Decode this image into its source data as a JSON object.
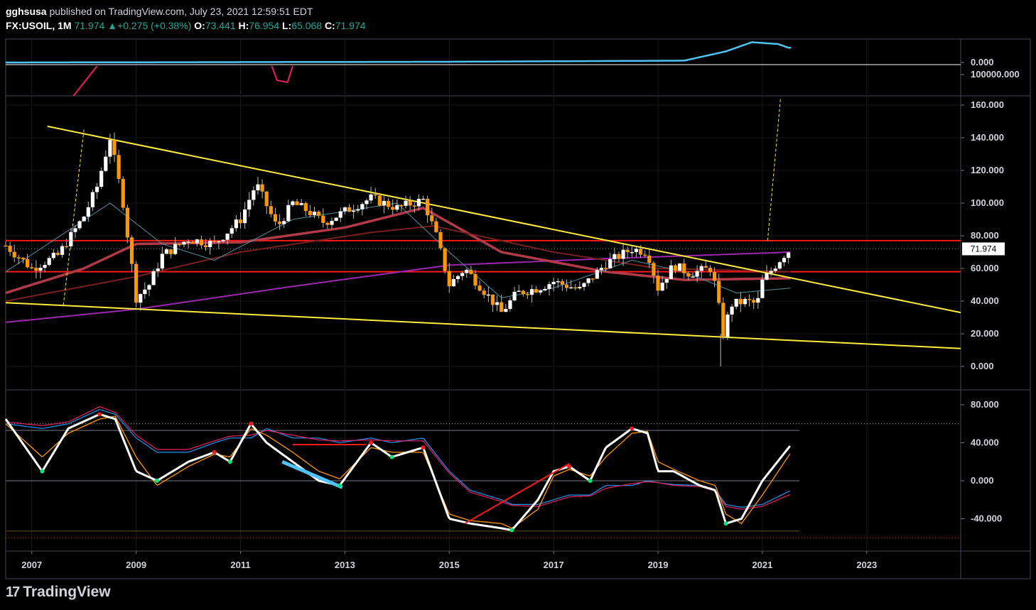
{
  "header": {
    "author": "gghsusa",
    "published_text": " published on TradingView.com, July 23, 2021 12:59:51 EDT",
    "symbol": "FX:USOIL, 1M",
    "last": "71.974",
    "change_arrow": "▲",
    "change": "+0.275 (+0.38%)",
    "open_label": "O:",
    "open": "73.441",
    "high_label": "H:",
    "high": "76.954",
    "low_label": "L:",
    "low": "65.068",
    "close_label": "C:",
    "close": "71.974"
  },
  "footer": {
    "brand": "TradingView",
    "logo_glyph": "17"
  },
  "colors": {
    "background": "#000000",
    "bull_candle": "#ffffff",
    "bear_candle": "#ff9800",
    "trendline": "#ffeb3b",
    "support_resistance": "#ff1a1a",
    "ma_purple": "#9c27b0",
    "ma_red": "#b23a48",
    "ma_dark": "#7a1f1f",
    "ma_teal": "#4f8f9f",
    "oscillator_fast": "#ffffff",
    "oscillator_slow": "#ff9800",
    "top_indicator": "#4fc3f7"
  },
  "chart_data": [
    {
      "type": "line",
      "panel": "top indicator",
      "y_tick_labels": [
        "0.000",
        "100000.000"
      ],
      "series": [
        {
          "values_note": "",
          "x": [
            2006.5,
            2015,
            2019.5,
            2020.3,
            2020.8,
            2021.3,
            2021.5
          ],
          "values": [
            0,
            0.2,
            0.5,
            3,
            5.5,
            5,
            4
          ]
        }
      ]
    },
    {
      "type": "candlestick",
      "panel": "price",
      "xlabel": "",
      "ylabel": "",
      "x_tick_labels": [
        "2007",
        "2009",
        "2011",
        "2013",
        "2015",
        "2017",
        "2019",
        "2021",
        "2023"
      ],
      "y_tick_labels": [
        "0.000",
        "20.000",
        "40.000",
        "60.000",
        "80.000",
        "100.000",
        "120.000",
        "140.000",
        "160.000"
      ],
      "ylim": [
        0,
        160
      ],
      "last_price_label": "71.974",
      "horizontal_levels": [
        77,
        58
      ],
      "trendlines": [
        {
          "x": [
            2007.3,
            2024.8
          ],
          "y": [
            147,
            33
          ]
        },
        {
          "x": [
            2006.5,
            2024.8
          ],
          "y": [
            39,
            11
          ]
        }
      ],
      "projection": {
        "x": [
          2021.1,
          2021.35
        ],
        "y": [
          77,
          165
        ]
      },
      "close_series": {
        "x": [
          2006.5,
          2007.0,
          2007.5,
          2008.0,
          2008.25,
          2008.5,
          2008.75,
          2009.0,
          2009.25,
          2009.5,
          2010.0,
          2010.5,
          2011.0,
          2011.3,
          2011.7,
          2012.0,
          2012.3,
          2012.6,
          2013.0,
          2013.5,
          2014.0,
          2014.5,
          2014.75,
          2015.0,
          2015.3,
          2015.7,
          2016.0,
          2016.3,
          2016.7,
          2017.0,
          2017.5,
          2018.0,
          2018.5,
          2018.8,
          2019.0,
          2019.3,
          2019.6,
          2020.0,
          2020.1,
          2020.25,
          2020.4,
          2020.7,
          2020.9,
          2021.0,
          2021.2,
          2021.4,
          2021.55
        ],
        "values": [
          74,
          60,
          68,
          92,
          110,
          140,
          100,
          42,
          50,
          68,
          78,
          75,
          90,
          112,
          85,
          100,
          95,
          88,
          95,
          103,
          97,
          102,
          80,
          50,
          60,
          45,
          33,
          45,
          48,
          52,
          47,
          63,
          72,
          70,
          48,
          62,
          57,
          60,
          49,
          20,
          38,
          40,
          38,
          52,
          60,
          68,
          72
        ]
      },
      "moving_averages": [
        {
          "color": "#9c27b0",
          "x": [
            2006.5,
            2009,
            2012,
            2015,
            2018,
            2021.55
          ],
          "values": [
            27,
            35,
            49,
            62,
            66,
            70
          ]
        },
        {
          "color": "#b23a48",
          "x": [
            2006.5,
            2008,
            2009,
            2011,
            2013,
            2014.5,
            2016,
            2018,
            2019.5,
            2021.55
          ],
          "values": [
            45,
            60,
            75,
            76,
            85,
            97,
            70,
            58,
            53,
            54
          ]
        },
        {
          "color": "#7a1f1f",
          "x": [
            2006.5,
            2009,
            2011,
            2013.5,
            2014.7,
            2017,
            2019,
            2021.55
          ],
          "values": [
            40,
            55,
            70,
            82,
            86,
            70,
            60,
            58
          ]
        },
        {
          "color": "#4f8f9f",
          "x": [
            2006.5,
            2008.5,
            2009.5,
            2010.5,
            2012,
            2014,
            2015,
            2016,
            2017,
            2018.5,
            2019.5,
            2020.5,
            2021.55
          ],
          "values": [
            58,
            100,
            75,
            65,
            90,
            100,
            70,
            42,
            48,
            65,
            58,
            45,
            48
          ]
        }
      ]
    },
    {
      "type": "line",
      "panel": "oscillator",
      "y_tick_labels": [
        "-40.000",
        "0.000",
        "40.000",
        "80.000"
      ],
      "ylim": [
        -60,
        80
      ],
      "levels": [
        53,
        0,
        -53
      ],
      "x": [
        2006.5,
        2007.2,
        2007.7,
        2008.3,
        2008.6,
        2009.0,
        2009.4,
        2010.0,
        2010.5,
        2010.8,
        2011.2,
        2011.5,
        2012.0,
        2012.5,
        2012.9,
        2013.5,
        2013.9,
        2014.5,
        2015.0,
        2015.4,
        2016.0,
        2016.2,
        2016.7,
        2017.0,
        2017.3,
        2017.7,
        2018.0,
        2018.5,
        2018.8,
        2019.0,
        2019.3,
        2019.8,
        2020.1,
        2020.3,
        2020.6,
        2021.0,
        2021.55
      ],
      "series": [
        {
          "values": [
            65,
            10,
            55,
            70,
            65,
            10,
            0,
            20,
            30,
            20,
            60,
            40,
            20,
            0,
            -5,
            40,
            25,
            35,
            -40,
            -45,
            -50,
            -52,
            -20,
            10,
            15,
            0,
            35,
            55,
            50,
            10,
            10,
            -5,
            -10,
            -45,
            -40,
            0,
            38
          ]
        },
        {
          "values": [
            60,
            25,
            50,
            65,
            68,
            25,
            -5,
            15,
            28,
            25,
            55,
            48,
            30,
            10,
            2,
            35,
            30,
            30,
            -35,
            -42,
            -45,
            -50,
            -30,
            5,
            12,
            5,
            25,
            50,
            52,
            20,
            12,
            0,
            -5,
            -35,
            -45,
            -15,
            30
          ]
        },
        {
          "values": [
            60,
            55,
            60,
            75,
            70,
            45,
            30,
            30,
            40,
            45,
            45,
            55,
            45,
            45,
            40,
            45,
            40,
            45,
            10,
            -10,
            -20,
            -25,
            -25,
            -20,
            -15,
            -15,
            -5,
            -5,
            0,
            -2,
            -4,
            -5,
            -10,
            -25,
            -28,
            -25,
            -10
          ]
        },
        {
          "values": [
            62,
            58,
            62,
            78,
            72,
            48,
            33,
            33,
            42,
            47,
            48,
            53,
            48,
            43,
            42,
            43,
            42,
            42,
            8,
            -12,
            -22,
            -26,
            -27,
            -22,
            -17,
            -16,
            -8,
            -3,
            -1,
            -2,
            -5,
            -6,
            -11,
            -27,
            -30,
            -27,
            -14
          ]
        }
      ],
      "divergence_lines": [
        {
          "color": "#4fc3f7",
          "x": [
            2011.8,
            2012.95
          ],
          "values": [
            20,
            -7
          ]
        },
        {
          "color": "#ff1a1a",
          "x": [
            2012.0,
            2013.4
          ],
          "values": [
            38,
            38
          ]
        },
        {
          "color": "#ff1a1a",
          "x": [
            2015.3,
            2017.3
          ],
          "values": [
            -45,
            18
          ]
        }
      ]
    }
  ]
}
